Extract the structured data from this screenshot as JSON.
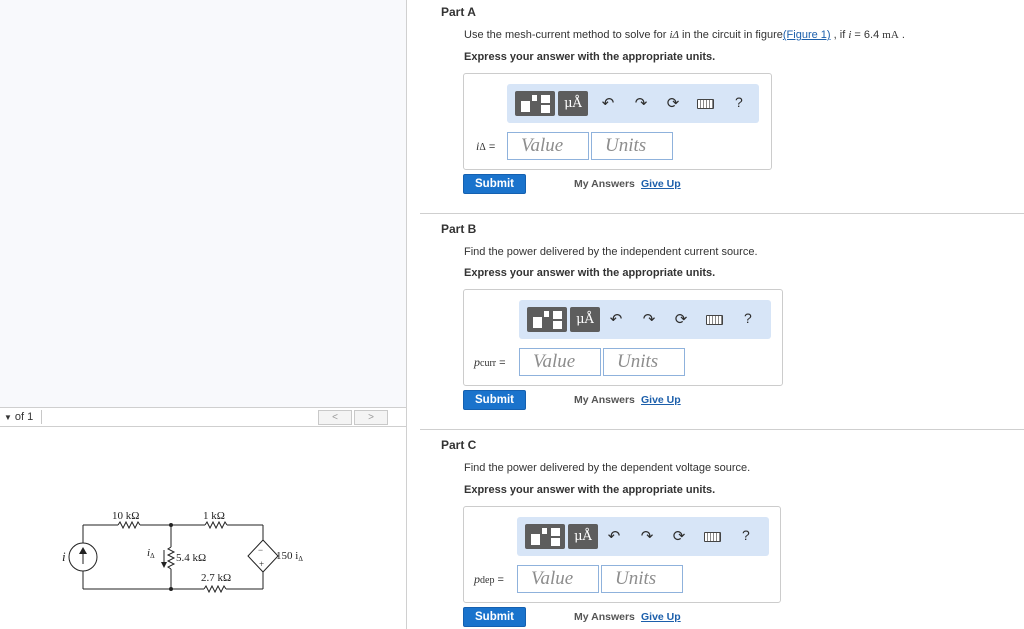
{
  "figure_pane": {
    "page_select": "of 1",
    "prev_label": "<",
    "next_label": ">",
    "circuit": {
      "source_label": "i",
      "r1": "10 kΩ",
      "r2": "1 kΩ",
      "r3": "5.4 kΩ",
      "r4": "2.7 kΩ",
      "current_var": "i",
      "current_sub": "Δ",
      "dep_source": "150 i",
      "dep_sub": "Δ"
    }
  },
  "parts": [
    {
      "title": "Part A",
      "prompt_pre": "Use the mesh-current method to solve for ",
      "prompt_var": "iΔ",
      "prompt_mid": " in the circuit in figure",
      "figure_link": "(Figure 1)",
      "prompt_post1": " , if ",
      "prompt_i": "i",
      "prompt_post2": " = 6.4 ",
      "prompt_unit": "mA",
      "prompt_end": " .",
      "express": "Express your answer with the appropriate units.",
      "var_main": "i",
      "var_sub": "Δ",
      "eq": " =",
      "value_placeholder": "Value",
      "units_placeholder": "Units",
      "submit": "Submit",
      "my_answers": "My Answers",
      "give_up": "Give Up"
    },
    {
      "title": "Part B",
      "prompt": "Find the power delivered by the independent current source.",
      "express": "Express your answer with the appropriate units.",
      "var_main": "p",
      "var_sub": "curr",
      "eq": " =",
      "value_placeholder": "Value",
      "units_placeholder": "Units",
      "submit": "Submit",
      "my_answers": "My Answers",
      "give_up": "Give Up"
    },
    {
      "title": "Part C",
      "prompt": "Find the power delivered by the dependent voltage source.",
      "express": "Express your answer with the appropriate units.",
      "var_main": "p",
      "var_sub": "dep",
      "eq": " =",
      "value_placeholder": "Value",
      "units_placeholder": "Units",
      "submit": "Submit",
      "my_answers": "My Answers",
      "give_up": "Give Up"
    }
  ],
  "toolbar": {
    "mu_label": "μÅ",
    "undo_icon": "undo-icon",
    "redo_icon": "redo-icon",
    "reset_icon": "reset-icon",
    "keyboard_icon": "keyboard-icon",
    "help_label": "?"
  },
  "colors": {
    "submit": "#1a73cc",
    "toolbar_bg": "#d7e5f7",
    "link": "#1c5fab"
  }
}
